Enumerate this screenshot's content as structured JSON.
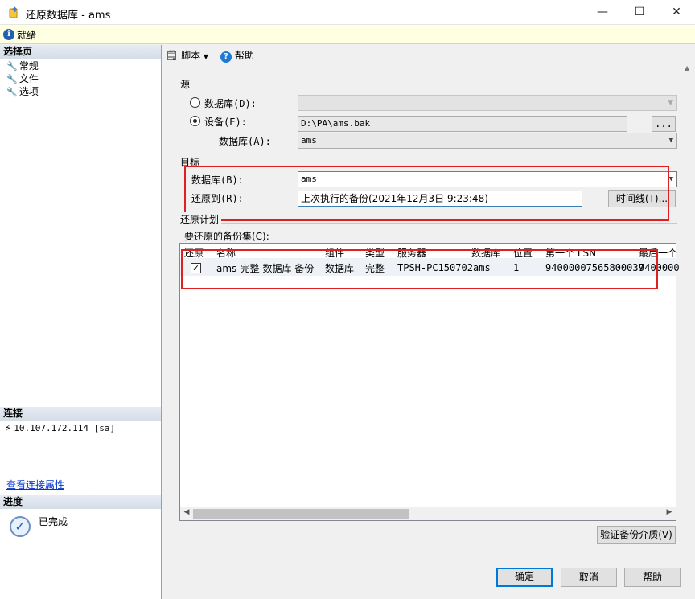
{
  "window": {
    "title": "还原数据库 - ams",
    "minimize": "—",
    "maximize": "☐",
    "close": "✕"
  },
  "status": {
    "text": "就绪"
  },
  "left": {
    "select_page_title": "选择页",
    "pages": [
      "常规",
      "文件",
      "选项"
    ],
    "connection_title": "连接",
    "connection_value": "10.107.172.114 [sa]",
    "view_props_link": "查看连接属性",
    "progress_title": "进度",
    "progress_status": "已完成"
  },
  "toolbar": {
    "script_label": "脚本",
    "help_label": "帮助"
  },
  "source": {
    "group_label": "源",
    "database_radio": "数据库(D):",
    "device_radio": "设备(E):",
    "device_path": "D:\\PA\\ams.bak",
    "browse_label": "...",
    "database_label": "数据库(A):",
    "database_value": "ams"
  },
  "destination": {
    "group_label": "目标",
    "database_label": "数据库(B):",
    "database_value": "ams",
    "restore_to_label": "还原到(R):",
    "restore_to_value": "上次执行的备份(2021年12月3日 9:23:48)",
    "timeline_label": "时间线(T)..."
  },
  "plan": {
    "group_label": "还原计划",
    "backup_sets_label": "要还原的备份集(C):",
    "columns": [
      "还原",
      "名称",
      "组件",
      "类型",
      "服务器",
      "数据库",
      "位置",
      "第一个 LSN",
      "最后一个"
    ],
    "rows": [
      {
        "checked": true,
        "name": "ams-完整 数据库 备份",
        "component": "数据库",
        "type": "完整",
        "server": "TPSH-PC150702",
        "database": "ams",
        "position": "1",
        "first_lsn": "94000007565800037",
        "last_lsn": "9400000"
      }
    ],
    "verify_label": "验证备份介质(V)"
  },
  "buttons": {
    "ok": "确定",
    "cancel": "取消",
    "help": "帮助"
  },
  "colors": {
    "highlight_box": "#e02020",
    "link": "#0033cc",
    "primary_border": "#0078d7"
  }
}
